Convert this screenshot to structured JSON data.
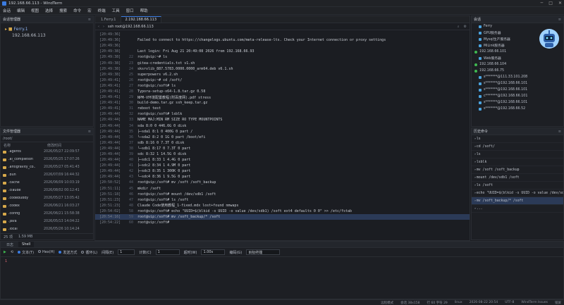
{
  "window": {
    "title": "192.168.66.113 - WindTerm"
  },
  "menu": [
    "会话",
    "编辑",
    "视图",
    "选择",
    "搜索",
    "命令",
    "宏",
    "终端",
    "工具",
    "窗口",
    "帮助"
  ],
  "sessions": {
    "header": "会话管理器",
    "items": [
      {
        "label": "Ferry.1"
      },
      {
        "label": "192.168.66.113"
      }
    ]
  },
  "files": {
    "header": "文件管理器",
    "path": "/root/",
    "cols": [
      "名称",
      "修改时间"
    ],
    "rows": [
      {
        "name": ".agents",
        "date": "2026/05/27 22:09:57"
      },
      {
        "name": ".ai_completion",
        "date": "2026/05/25 17:07:26"
      },
      {
        "name": ".antigravity_co..",
        "date": "2026/05/27 05:41:43"
      },
      {
        "name": ".bun",
        "date": "2026/07/09 16:44:32"
      },
      {
        "name": ".cache",
        "date": "2026/06/09 10:03:19"
      },
      {
        "name": ".claude",
        "date": "2026/08/02 00:12:41"
      },
      {
        "name": ".codebuddy",
        "date": "2026/05/27 13:05:42"
      },
      {
        "name": ".codex",
        "date": "2026/06/21 16:03:27"
      },
      {
        "name": ".config",
        "date": "2026/06/21 15:58:38"
      },
      {
        "name": ".java",
        "date": "2026/05/13 14:04:22"
      },
      {
        "name": ".local",
        "date": "2026/05/26 10:14:24"
      }
    ],
    "footer_count": "25 项",
    "footer_size": "1.59 MB"
  },
  "terminal": {
    "tabs": [
      {
        "label": "1.Ferry.1"
      },
      {
        "label": "2.192.168.66.113"
      }
    ],
    "address": "ssh root@192.168.66.113",
    "lines": [
      {
        "ts": "[20:49:36]",
        "ln": "",
        "text": "",
        "c": ""
      },
      {
        "ts": "[20:49:36]",
        "ln": "",
        "text": "Failed to connect to https://changelogs.ubuntu.com/meta-release-lts. Check your Internet connection or proxy settings",
        "c": "red"
      },
      {
        "ts": "[20:49:36]",
        "ln": "",
        "text": "",
        "c": ""
      },
      {
        "ts": "[20:49:38]",
        "ln": "",
        "text": "Last login: Fri Aug 21 20:49:08 2026 from 192.168.66.93",
        "c": ""
      },
      {
        "ts": "[20:49:38]",
        "ln": "22",
        "text": "root@vip:~# ls",
        "c": ""
      },
      {
        "ts": "[20:49:38]",
        "ln": "23",
        "text": "gitea-credentials.txt                v1.sh",
        "c": ""
      },
      {
        "ts": "[20:49:38]",
        "ln": "24",
        "text": "sksrvlib_887.5783.0000.0000_arm64.deb    v6.1.sh",
        "c": "red"
      },
      {
        "ts": "[20:49:38]",
        "ln": "25",
        "text": "superpowers                          v6.2.sh",
        "c": "cyn"
      },
      {
        "ts": "[20:49:41]",
        "ln": "26",
        "text": "root@vip:~# cd /soft/",
        "c": ""
      },
      {
        "ts": "[20:49:41]",
        "ln": "27",
        "text": "root@vip:/soft# ls",
        "c": ""
      },
      {
        "ts": "[20:49:41]",
        "ln": "28",
        "text": "Typora-setup-x64-1.8.tar.gz          0.58",
        "c": "red"
      },
      {
        "ts": "[20:49:41]",
        "ln": "29",
        "text": "NPM-V环境配置教程(附百度网).pdf       stress",
        "c": ""
      },
      {
        "ts": "[20:49:41]",
        "ln": "30",
        "text": "build-demo.tar.gz                    ssh_keep.tar.gz",
        "c": "red"
      },
      {
        "ts": "[20:49:41]",
        "ln": "31",
        "text": "reboot                               test",
        "c": "red"
      },
      {
        "ts": "[20:49:44]",
        "ln": "32",
        "text": "root@vip:/soft# lsblk",
        "c": ""
      },
      {
        "ts": "[20:49:44]",
        "ln": "33",
        "text": "NAME    MAJ:MIN RM   SIZE RO TYPE MOUNTPOINTS",
        "c": ""
      },
      {
        "ts": "[20:49:44]",
        "ln": "34",
        "text": "sda       8:0    0 446.6G  0 disk",
        "c": ""
      },
      {
        "ts": "[20:49:44]",
        "ln": "35",
        "text": "├─sda1    8:1    0   400G  0 part /",
        "c": ""
      },
      {
        "ts": "[20:49:44]",
        "ln": "36",
        "text": "└─sda2    8:2    0     1G  0 part /boot/efi",
        "c": ""
      },
      {
        "ts": "[20:49:44]",
        "ln": "37",
        "text": "sdb       8:16   0   7.3T  0 disk",
        "c": ""
      },
      {
        "ts": "[20:49:44]",
        "ln": "38",
        "text": "└─sdb1    8:17   0   7.3T  0 part",
        "c": ""
      },
      {
        "ts": "[20:49:44]",
        "ln": "39",
        "text": "sdc       8:32   1  14.5G  0 disk",
        "c": ""
      },
      {
        "ts": "[20:49:44]",
        "ln": "40",
        "text": "├─sdc1    8:33   1   4.4G  0 part",
        "c": ""
      },
      {
        "ts": "[20:49:44]",
        "ln": "41",
        "text": "├─sdc2    8:34   1   4.9M  0 part",
        "c": ""
      },
      {
        "ts": "[20:49:44]",
        "ln": "42",
        "text": "├─sdc3    8:35   1   300K  0 part",
        "c": ""
      },
      {
        "ts": "[20:49:44]",
        "ln": "43",
        "text": "└─sdc4    8:36   1   9.5G  0 part",
        "c": ""
      },
      {
        "ts": "[20:50:52]",
        "ln": "44",
        "text": "root@vip:/soft# mv /soft /soft_backup",
        "c": ""
      },
      {
        "ts": "[20:51:11]",
        "ln": "45",
        "text": "mkdir /soft",
        "c": ""
      },
      {
        "ts": "[20:51:18]",
        "ln": "46",
        "text": "root@vip:/soft# mount /dev/sdb1 /soft",
        "c": ""
      },
      {
        "ts": "[20:51:23]",
        "ln": "47",
        "text": "root@vip:/soft# ls /soft",
        "c": ""
      },
      {
        "ts": "[20:51:23]",
        "ln": "48",
        "text": " Claude Code使用教程_1-fixed.mdx    lost+found    nmwaps",
        "c": "ylw"
      },
      {
        "ts": "[20:54:02]",
        "ln": "58",
        "text": "root@vip:/soft# echo \"UUID=$(blkid -s UUID -o value /dev/sdb1) /soft ext4 defaults 0 0\" >> /etc/fstab",
        "c": ""
      },
      {
        "ts": "[20:54:16]",
        "ln": "59",
        "text": "root@vip:/soft# mv /soft_backup/* /soft",
        "c": "hl"
      },
      {
        "ts": "[20:54:22]",
        "ln": "60",
        "text": "root@vip:/soft# ",
        "c": "cur"
      }
    ]
  },
  "sysinfo": {
    "header": "会话",
    "items": [
      {
        "label": "Ferry",
        "kind": "sub"
      },
      {
        "label": "GPU服务器",
        "kind": "sub"
      },
      {
        "label": "Mysql生产服务器",
        "kind": "sub"
      },
      {
        "label": "MiLink服务器",
        "kind": "sub"
      },
      {
        "label": "192.168.66.101",
        "kind": "dot"
      },
      {
        "label": "Web服务器",
        "kind": "sub"
      },
      {
        "label": "192.168.66.104",
        "kind": "dot"
      },
      {
        "label": "192.168.66.75",
        "kind": "dot"
      },
      {
        "label": "s*******@111.33.101.208",
        "kind": "sub"
      },
      {
        "label": "s*******@192.168.66.101",
        "kind": "sub"
      },
      {
        "label": "s*******@192.168.66.101",
        "kind": "sub"
      },
      {
        "label": "c*******@192.168.66.101",
        "kind": "sub"
      },
      {
        "label": "s*******@192.168.66.101",
        "kind": "sub"
      },
      {
        "label": "s*******@192.168.66.52",
        "kind": "sub"
      }
    ]
  },
  "history": {
    "header": "历史命令",
    "items": [
      "ls",
      "cd /soft/",
      "ls",
      "lsblk",
      "mv /soft /soft_backup",
      "mount /dev/sdb1 /soft",
      "ls /soft",
      "echo \"UUID=$(blkid -s UUID -o value /dev/sdb1)",
      "mv /soft_backup/* /soft",
      "..."
    ],
    "selected": 8
  },
  "bottom": {
    "tabs": [
      {
        "label": "日志"
      },
      {
        "label": "Shell"
      }
    ],
    "options": {
      "text": "文本(T)",
      "hex": "Hex(H)",
      "send_mode": "发送方式",
      "loop": "循环(L)",
      "interval_label": "间隔(E)",
      "interval": "1",
      "count_label": "计数(C)",
      "count": "1",
      "timeout_label": "超时(W)",
      "timeout": "1.00s",
      "encoding_label": "编码(G)",
      "encoding": "目标终端"
    }
  },
  "status": {
    "left": "",
    "items": [
      "远程模式",
      "会话 38x158",
      "行 60 字符 29",
      "linux",
      "2026-08-22 20:54",
      "UTF-8",
      "WindTerm Issues",
      "锁屏"
    ]
  }
}
